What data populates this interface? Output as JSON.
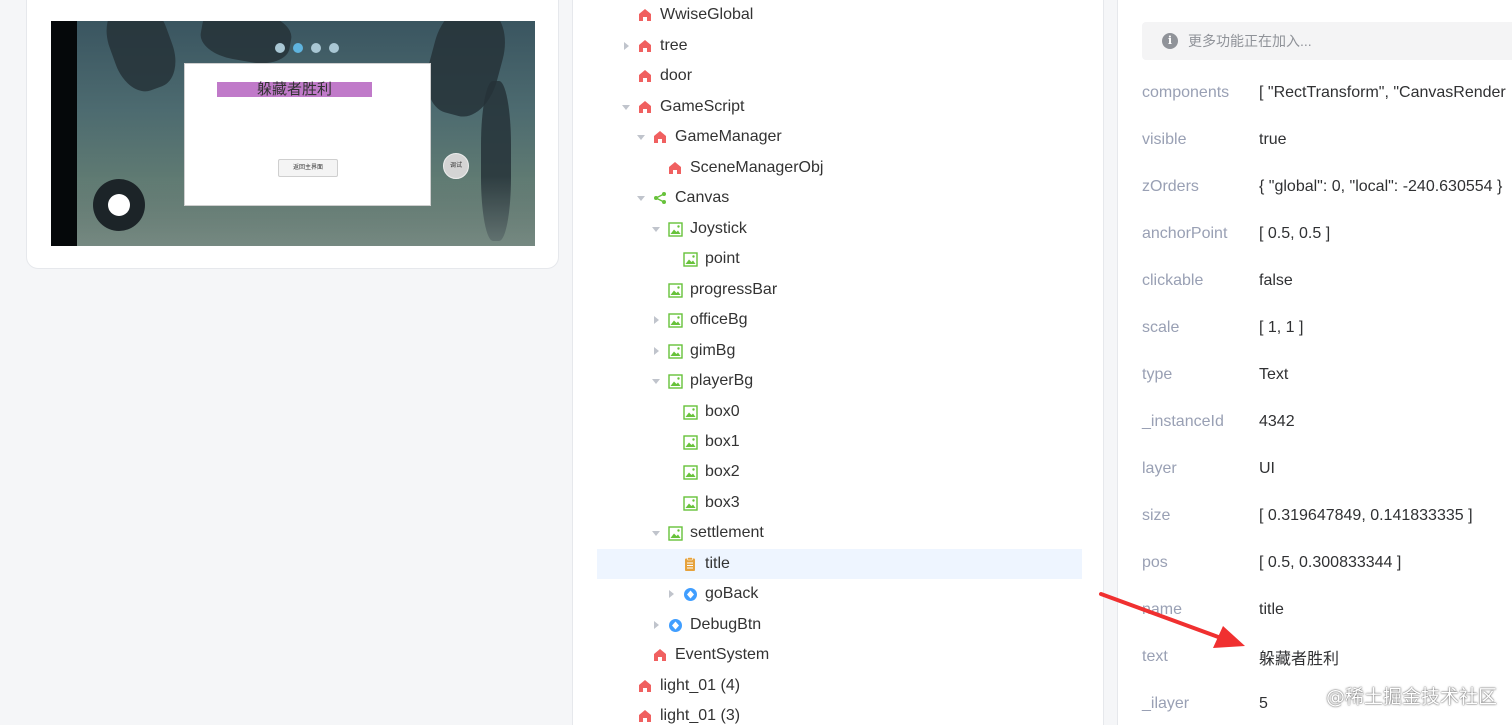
{
  "preview": {
    "dialog_title": "躲藏者胜利",
    "dialog_button": "返回主界面",
    "debug_button": "调试"
  },
  "tree": {
    "nodes": [
      {
        "label": "WwiseGlobal",
        "icon": "home-icon"
      },
      {
        "label": "tree",
        "icon": "home-icon"
      },
      {
        "label": "door",
        "icon": "home-icon"
      },
      {
        "label": "GameScript",
        "icon": "home-icon"
      },
      {
        "label": "GameManager",
        "icon": "home-icon"
      },
      {
        "label": "SceneManagerObj",
        "icon": "home-icon"
      },
      {
        "label": "Canvas",
        "icon": "share-icon"
      },
      {
        "label": "Joystick",
        "icon": "image-icon"
      },
      {
        "label": "point",
        "icon": "image-icon"
      },
      {
        "label": "progressBar",
        "icon": "image-icon"
      },
      {
        "label": "officeBg",
        "icon": "image-icon"
      },
      {
        "label": "gimBg",
        "icon": "image-icon"
      },
      {
        "label": "playerBg",
        "icon": "image-icon"
      },
      {
        "label": "box0",
        "icon": "image-icon"
      },
      {
        "label": "box1",
        "icon": "image-icon"
      },
      {
        "label": "box2",
        "icon": "image-icon"
      },
      {
        "label": "box3",
        "icon": "image-icon"
      },
      {
        "label": "settlement",
        "icon": "image-icon"
      },
      {
        "label": "title",
        "icon": "text-icon"
      },
      {
        "label": "goBack",
        "icon": "button-icon"
      },
      {
        "label": "DebugBtn",
        "icon": "button-icon"
      },
      {
        "label": "EventSystem",
        "icon": "home-icon"
      },
      {
        "label": "light_01 (4)",
        "icon": "home-icon"
      },
      {
        "label": "light_01 (3)",
        "icon": "home-icon"
      }
    ]
  },
  "properties": {
    "notice": "更多功能正在加入...",
    "rows": [
      {
        "key": "components",
        "value": "[ \"RectTransform\", \"CanvasRender"
      },
      {
        "key": "visible",
        "value": "true"
      },
      {
        "key": "zOrders",
        "value": "{ \"global\": 0, \"local\": -240.630554 }"
      },
      {
        "key": "anchorPoint",
        "value": "[ 0.5, 0.5 ]"
      },
      {
        "key": "clickable",
        "value": "false"
      },
      {
        "key": "scale",
        "value": "[ 1, 1 ]"
      },
      {
        "key": "type",
        "value": "Text"
      },
      {
        "key": "_instanceId",
        "value": "4342"
      },
      {
        "key": "layer",
        "value": "UI"
      },
      {
        "key": "size",
        "value": "[ 0.319647849, 0.141833335 ]"
      },
      {
        "key": "pos",
        "value": "[ 0.5, 0.300833344 ]"
      },
      {
        "key": "name",
        "value": "title"
      },
      {
        "key": "text",
        "value": "躲藏者胜利"
      },
      {
        "key": "_ilayer",
        "value": "5"
      }
    ]
  },
  "watermark": "@稀土掘金技术社区",
  "colors": {
    "home_icon": "#f06060",
    "image_icon": "#67c23a",
    "share_icon": "#67c23a",
    "text_icon": "#e6a23c",
    "button_icon": "#409eff",
    "selected_row": "#eef5ff",
    "arrow": "#f03030"
  }
}
